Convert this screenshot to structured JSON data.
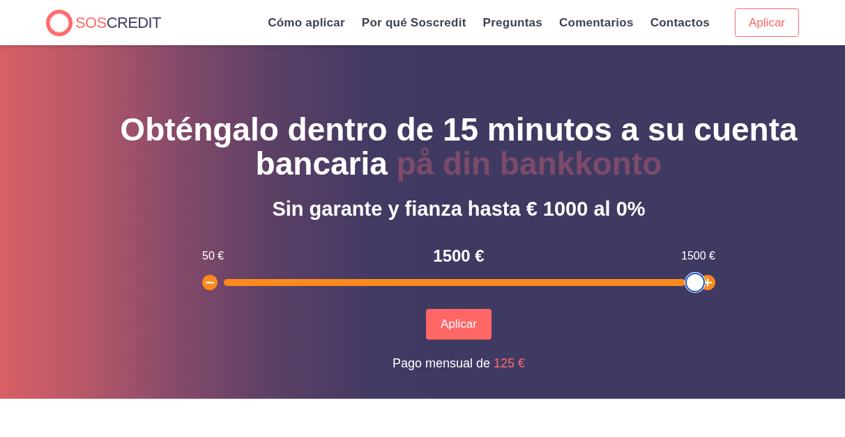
{
  "header": {
    "logo": {
      "accent": "SOS",
      "rest": "CREDIT"
    },
    "nav": [
      "Cómo aplicar",
      "Por qué Soscredit",
      "Preguntas",
      "Comentarios",
      "Contactos"
    ],
    "cta": "Aplicar"
  },
  "hero": {
    "heading": {
      "text": "Obténgalo dentro de 15 minutos a su cuenta bancaria",
      "faded": "på din bankkonto"
    },
    "subheading": "Sin garante y fianza hasta € 1000 al 0%",
    "slider": {
      "min_label": "50 €",
      "value": "1500 €",
      "max_label": "1500 €",
      "level": 1
    },
    "apply_button": "Aplicar",
    "monthly": {
      "label": "Pago mensual de",
      "amount": "125 €"
    }
  }
}
